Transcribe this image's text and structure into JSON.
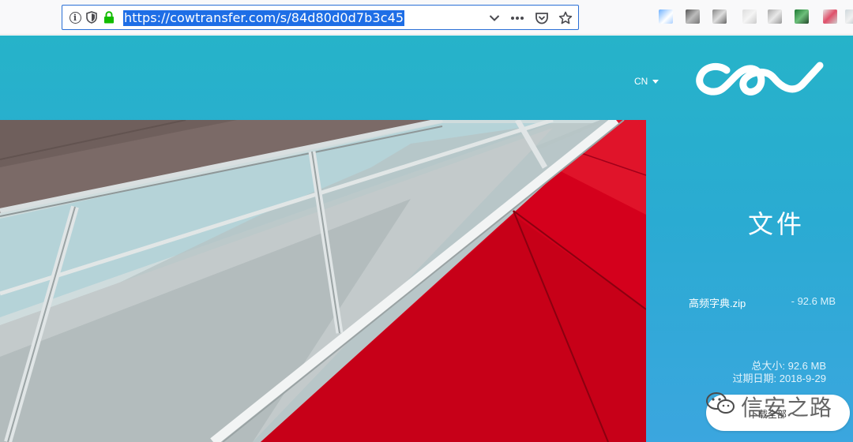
{
  "browser": {
    "url": "https://cowtransfer.com/s/84d80d0d7b3c45",
    "info_glyph": "i",
    "icons": [
      "info-icon",
      "shield-icon",
      "lock-icon",
      "chevron-down-icon",
      "more-icon",
      "pocket-icon",
      "star-icon"
    ]
  },
  "header": {
    "language": "CN",
    "logo": "cowtransfer-logo"
  },
  "main": {
    "title": "文件",
    "file": {
      "name": "高频字典.zip",
      "size": "- 92.6 MB"
    },
    "total_size": "总大小: 92.6 MB",
    "expire_date": "过期日期: 2018-9-29",
    "download_label": "下载全部"
  },
  "watermark": {
    "text": "信安之路",
    "icon": "wechat-icon"
  },
  "colors": {
    "page_bg_top": "#26b3c9",
    "page_bg_bottom": "#3ba6df",
    "url_highlight": "#1e6ee6",
    "accent_red": "#d4001c"
  }
}
